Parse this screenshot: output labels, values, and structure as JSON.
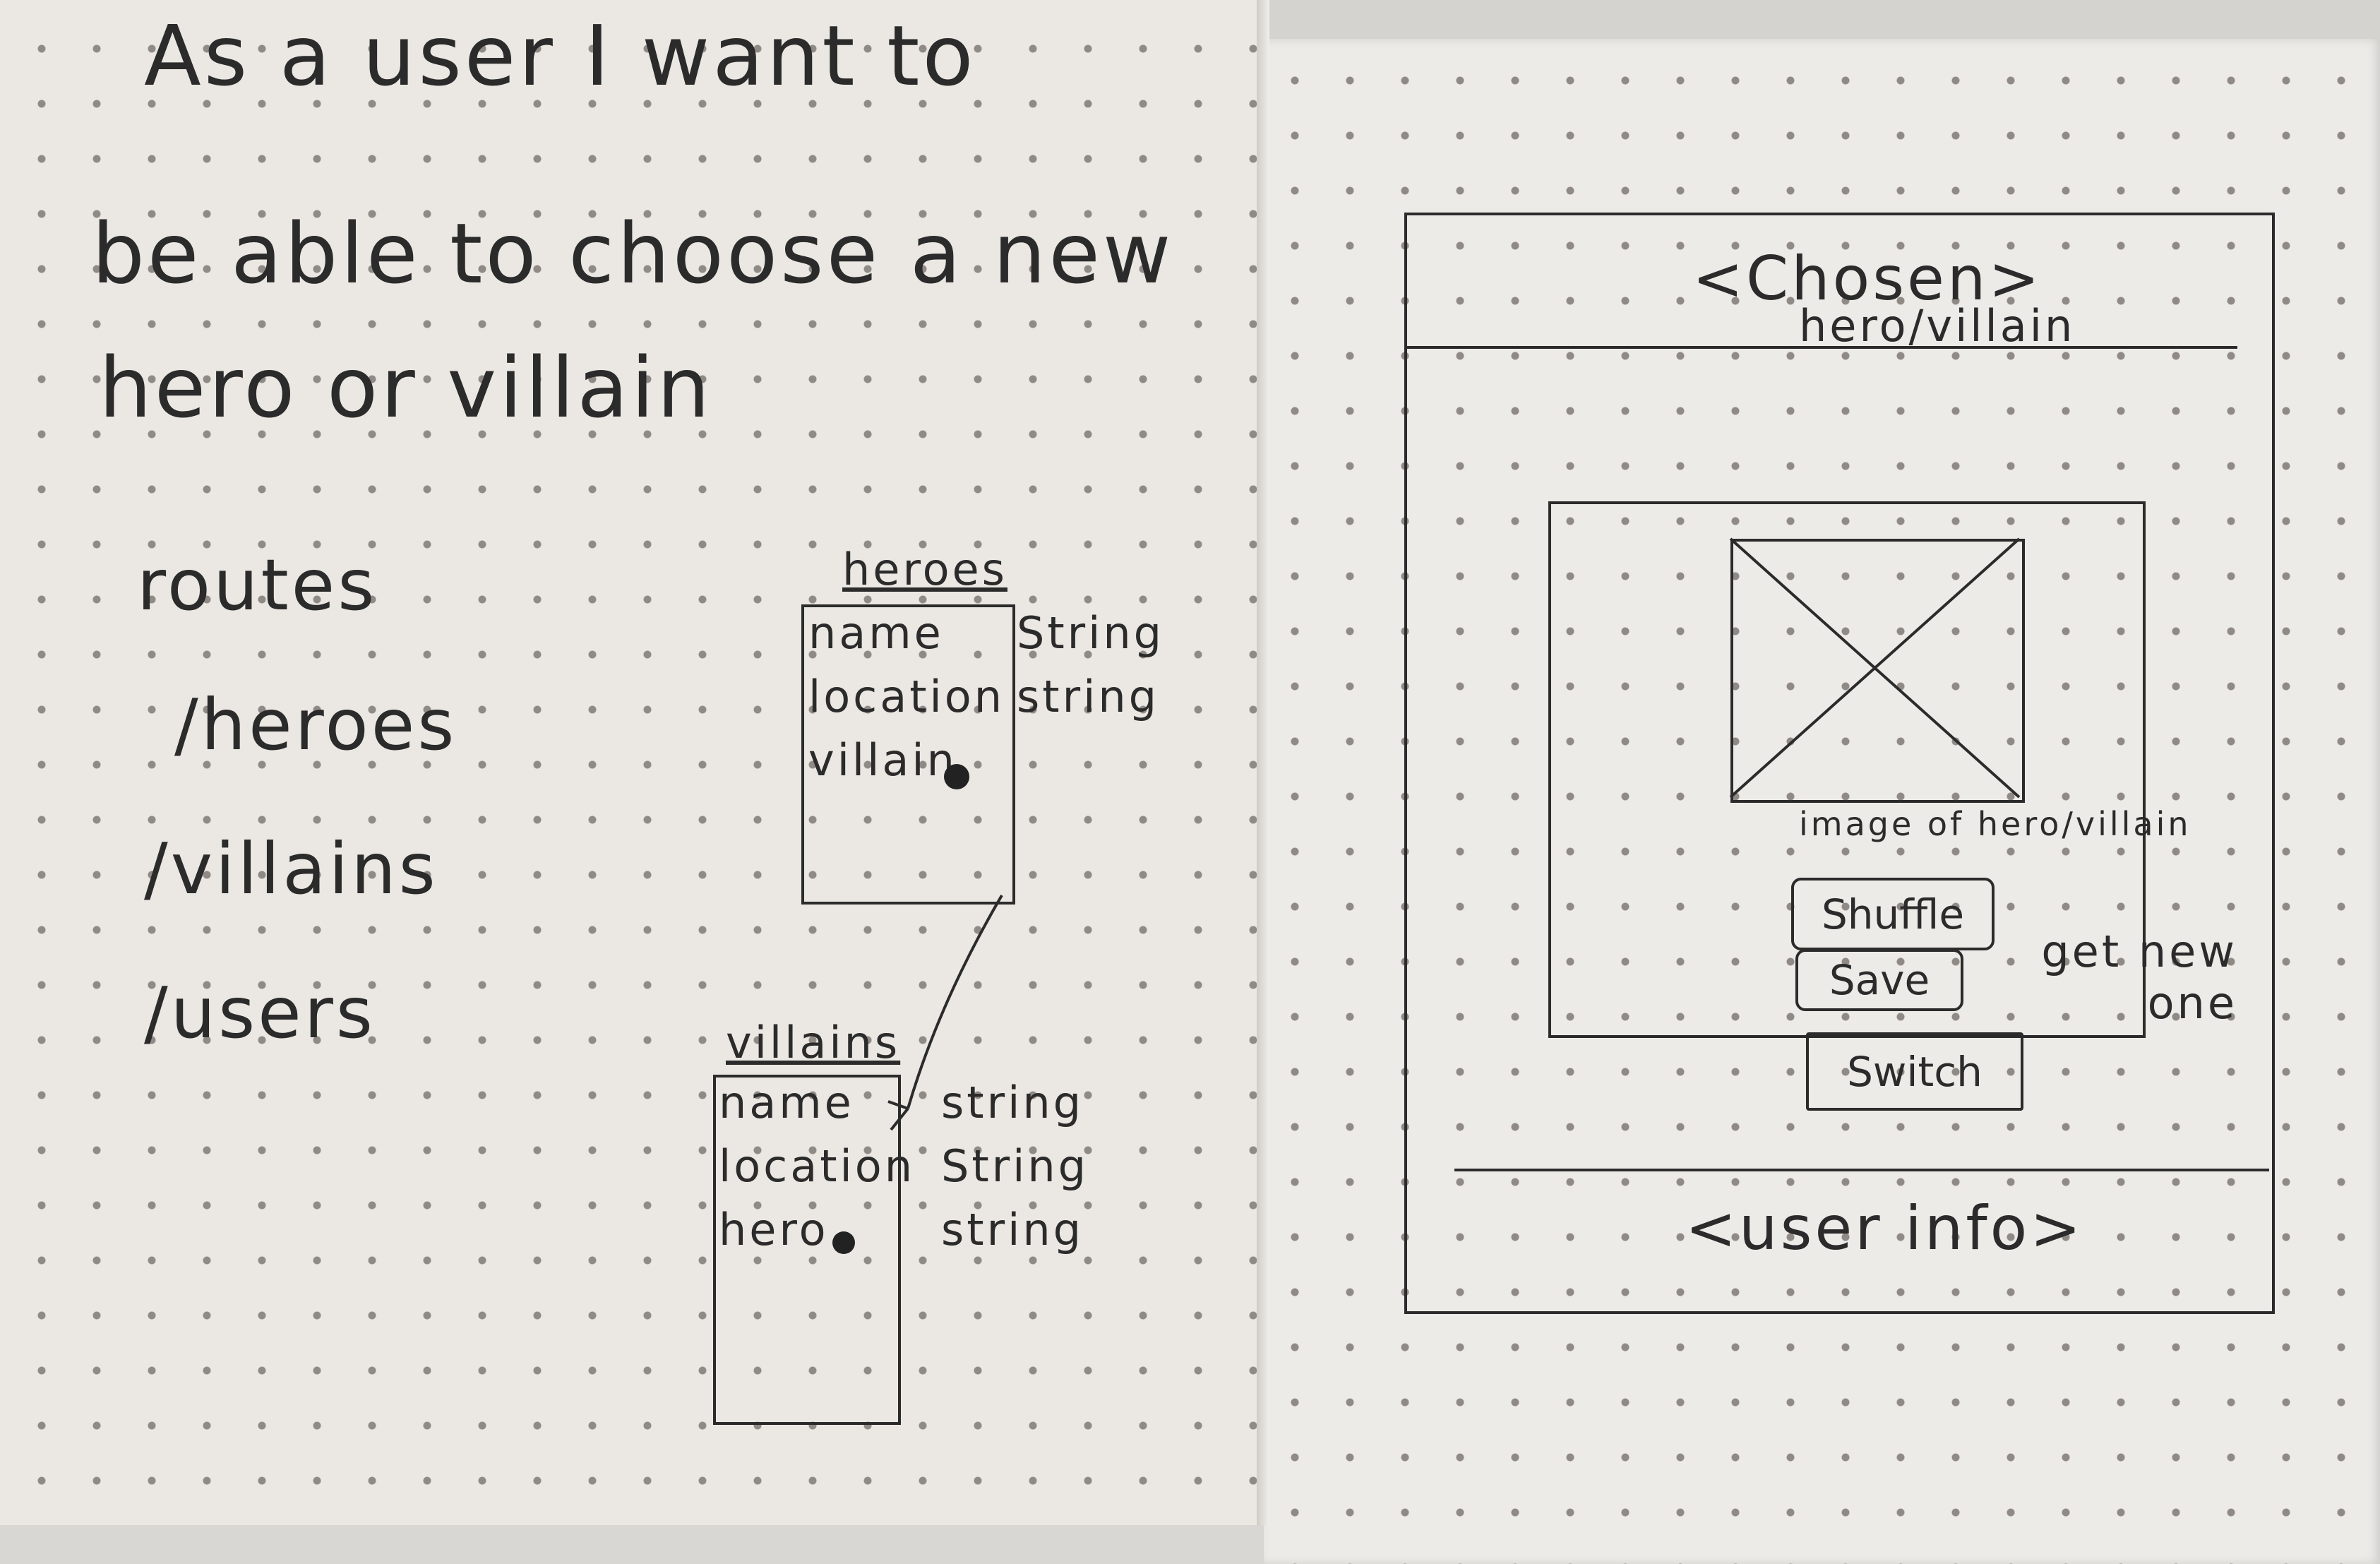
{
  "user_story": {
    "line1": "As a user I want to",
    "line2": "be able to choose a new",
    "line3": "hero or villain"
  },
  "routes": {
    "title": "routes",
    "items": [
      "/heroes",
      "/villains",
      "/users"
    ]
  },
  "models": {
    "heroes": {
      "title": "heroes",
      "fields": [
        {
          "name": "name",
          "type": "String"
        },
        {
          "name": "location",
          "type": "string"
        },
        {
          "name": "villain",
          "type": ""
        }
      ]
    },
    "villains": {
      "title": "villains",
      "fields": [
        {
          "name": "name",
          "type": "string"
        },
        {
          "name": "location",
          "type": "String"
        },
        {
          "name": "hero",
          "type": "string"
        }
      ]
    }
  },
  "wireframe": {
    "header": {
      "title": "<Chosen>",
      "subtitle": "hero/villain"
    },
    "image_caption": "image of hero/villain",
    "buttons": {
      "shuffle": "Shuffle",
      "save": "Save",
      "switch": "Switch"
    },
    "shuffle_note": "get new one",
    "footer": "<user info>"
  }
}
